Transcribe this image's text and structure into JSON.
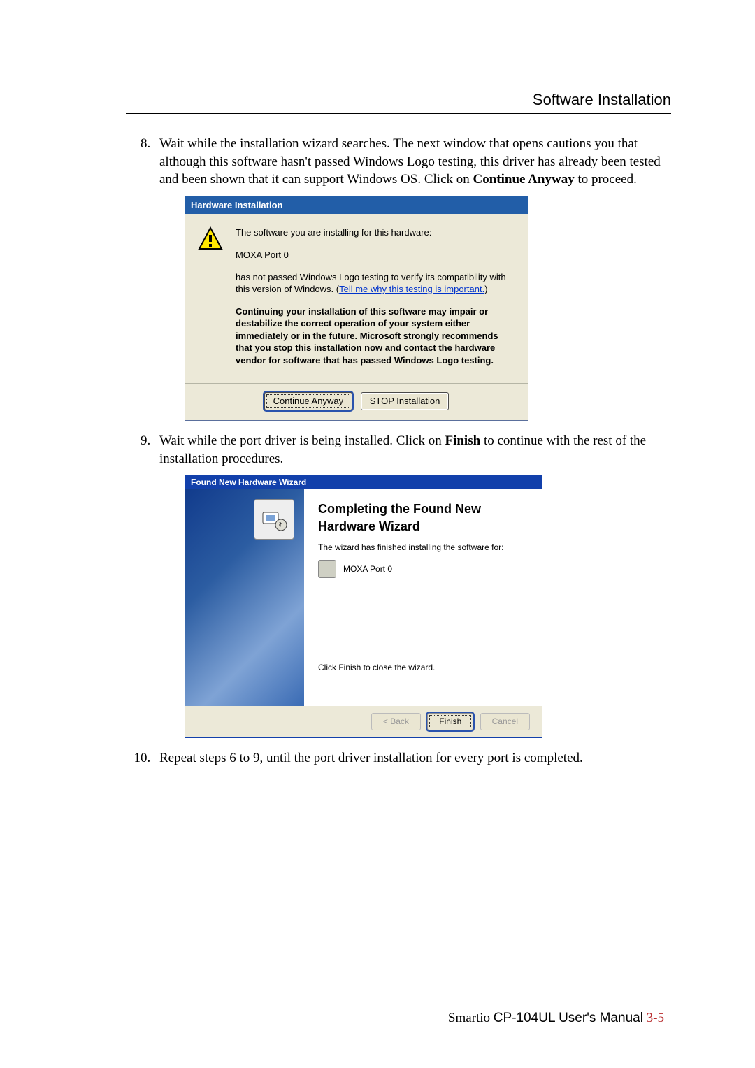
{
  "header": {
    "title": "Software Installation"
  },
  "steps": {
    "start": 8,
    "s8_a": "Wait while the installation wizard searches. The next window that opens cautions you that although this software hasn't passed Windows Logo testing, this driver has already been tested and been shown that it can support Windows OS. Click on ",
    "s8_bold": "Continue Anyway",
    "s8_b": " to proceed.",
    "s9_a": "Wait while the port driver is being installed. Click on ",
    "s9_bold": "Finish",
    "s9_b": " to continue with the rest of the installation procedures.",
    "s10": "Repeat steps 6 to 9, until the port driver installation for every port is completed."
  },
  "dialog1": {
    "title": "Hardware Installation",
    "line1": "The software you are installing for this hardware:",
    "device": "MOXA Port 0",
    "line2_a": "has not passed Windows Logo testing to verify its compatibility with this version of Windows. (",
    "link": "Tell me why this testing is important.",
    "line2_b": ")",
    "warning": "Continuing your installation of this software may impair or destabilize the correct operation of your system either immediately or in the future. Microsoft strongly recommends that you stop this installation now and contact the hardware vendor for software that has passed Windows Logo testing.",
    "btn_continue": "Continue Anyway",
    "btn_stop": "STOP Installation"
  },
  "dialog2": {
    "title": "Found New Hardware Wizard",
    "heading": "Completing the Found New Hardware Wizard",
    "sub": "The wizard has finished installing the software for:",
    "device": "MOXA Port 0",
    "closing": "Click Finish to close the wizard.",
    "btn_back": "< Back",
    "btn_finish": "Finish",
    "btn_cancel": "Cancel"
  },
  "footer": {
    "brand": "Smartio ",
    "manual": "CP-104UL User's Manual",
    "page": "   3-5"
  }
}
